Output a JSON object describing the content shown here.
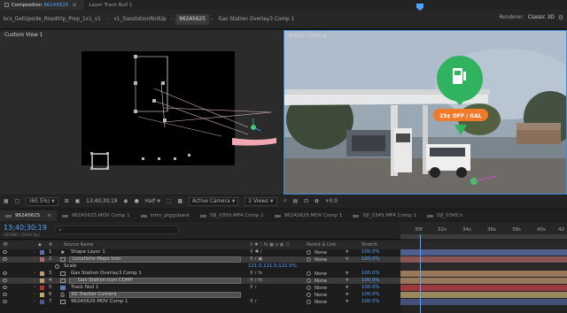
{
  "top_tabs": [
    {
      "prefix": "Composition",
      "name": "962A5625",
      "active": true
    },
    {
      "prefix": "Layer",
      "name": "Track Null 1",
      "active": false
    }
  ],
  "breadcrumbs": [
    {
      "label": "bcs_GetUpside_Roadtrip_Prep_1x1_v1",
      "active": false
    },
    {
      "label": "v1_GasstationRollUp",
      "active": false
    },
    {
      "label": "962A5625",
      "active": true
    },
    {
      "label": "Gas Station Overlay3 Comp 1",
      "active": false
    }
  ],
  "renderer": {
    "label": "Renderer:",
    "value": "Classic 3D"
  },
  "viewers": {
    "left_label": "Custom View 1",
    "right_label": "Active Camera",
    "overlay_text": "25¢ OFF / GAL"
  },
  "viewer_toolbar": {
    "zoom": "(60.5%)",
    "timecode": "13;40;30;19",
    "resolution": "Half",
    "camera": "Active Camera",
    "views": "2 Views",
    "exposure": "+0.0"
  },
  "timeline_tabs": [
    {
      "label": "962A5625",
      "active": true
    },
    {
      "label": "962A5625.MOV Comp 1",
      "active": false
    },
    {
      "label": "Intro_piggybank",
      "active": false
    },
    {
      "label": "DJI_0350.MP4 Comp 1",
      "active": false
    },
    {
      "label": "962A5625.MOV Comp 1",
      "active": false
    },
    {
      "label": "DJI_0345.MP4 Comp 1",
      "active": false
    },
    {
      "label": "DJI_0345.h",
      "active": false
    }
  ],
  "timeline": {
    "timecode": "13;40;30;19",
    "frame_info": "2955867 (59.94 fps)",
    "ruler_ticks": [
      "30f",
      "32s",
      "34s",
      "36s",
      "38s",
      "40s",
      "42"
    ]
  },
  "columns": {
    "source_name": "Source Name",
    "parent": "Parent & Link",
    "stretch": "Stretch"
  },
  "layers": [
    {
      "num": "1",
      "name": "Shape Layer 1",
      "parent": "None",
      "stretch": "100.0%",
      "label_color": "#5a6fb0",
      "selected": false,
      "boxed": false,
      "twirl": "›"
    },
    {
      "num": "2",
      "name": "Locations Maps Icon",
      "parent": "None",
      "stretch": "100.0%",
      "label_color": "#b06a6a",
      "selected": true,
      "boxed": true,
      "twirl": "⌄"
    },
    {
      "num": "3",
      "name": "Gas Station Overlay3 Comp 1",
      "parent": "None",
      "stretch": "100.0%",
      "label_color": "#c49a6a",
      "selected": false,
      "boxed": false,
      "twirl": "›"
    },
    {
      "num": "4",
      "name": "Gas Station Icon COMP",
      "parent": "None",
      "stretch": "100.0%",
      "label_color": "#c49a6a",
      "selected": true,
      "boxed": true,
      "twirl": "›"
    },
    {
      "num": "5",
      "name": "Track Null 1",
      "parent": "None",
      "stretch": "100.0%",
      "label_color": "#b3343a",
      "selected": false,
      "boxed": false,
      "twirl": "›"
    },
    {
      "num": "6",
      "name": "3D Tracker Camera",
      "parent": "None",
      "stretch": "100.0%",
      "label_color": "#c0a96a",
      "selected": false,
      "boxed": true,
      "twirl": "›"
    },
    {
      "num": "7",
      "name": "962A5625.MOV Comp 1",
      "parent": "None",
      "stretch": "100.0%",
      "label_color": "#4a5a8a",
      "selected": false,
      "boxed": false,
      "twirl": "›"
    }
  ],
  "scale_prop": {
    "label": "Scale",
    "value": "121.0,121.0,121.0%"
  },
  "colors": {
    "accent": "#4ea3ff",
    "gas_green": "#2fb35e",
    "overlay_orange": "#f07a2a"
  }
}
